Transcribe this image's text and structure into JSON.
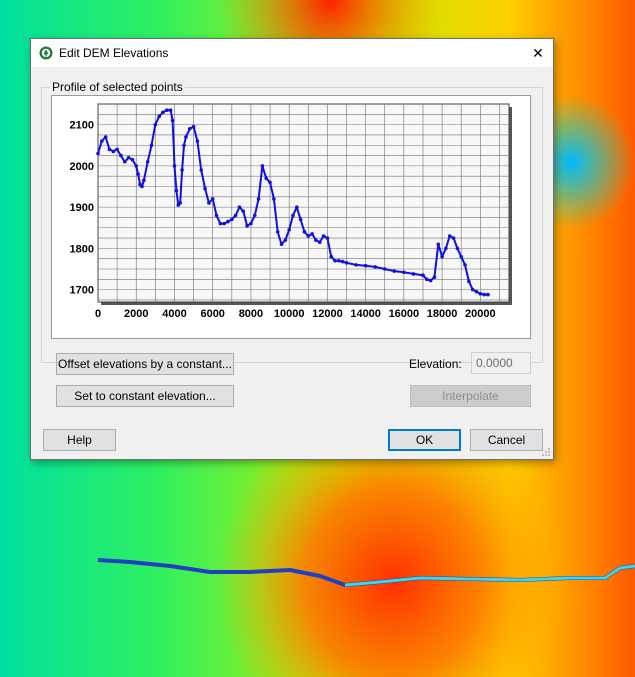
{
  "dialog": {
    "title": "Edit DEM Elevations",
    "close_glyph": "✕",
    "app_icon": "arcgis-app-icon"
  },
  "profile": {
    "group_label": "Profile of selected points"
  },
  "controls": {
    "offset_button": "Offset elevations by a constant...",
    "set_constant_button": "Set to constant elevation...",
    "elevation_label": "Elevation:",
    "elevation_value": "0.0000",
    "interpolate_button": "Interpolate",
    "help_button": "Help",
    "ok_button": "OK",
    "cancel_button": "Cancel"
  },
  "colors": {
    "profile_line": "#1010e0",
    "grid": "#707070",
    "plot_bg": "#f7f7f7",
    "accent": "#0078d7"
  },
  "chart_data": {
    "type": "line",
    "title": "",
    "xlabel": "",
    "ylabel": "",
    "xlim": [
      0,
      21500
    ],
    "ylim": [
      1670,
      2150
    ],
    "x_ticks": [
      0,
      2000,
      4000,
      6000,
      8000,
      10000,
      12000,
      14000,
      16000,
      18000,
      20000
    ],
    "y_ticks": [
      1700,
      1800,
      1900,
      2000,
      2100
    ],
    "grid": true,
    "series": [
      {
        "x": [
          0,
          200,
          400,
          600,
          800,
          1000,
          1200,
          1400,
          1600,
          1800,
          2000,
          2100,
          2200,
          2300,
          2400,
          2600,
          2800,
          3000,
          3200,
          3400,
          3600,
          3800,
          3900,
          4000,
          4100,
          4200,
          4300,
          4400,
          4500,
          4600,
          4800,
          5000,
          5200,
          5400,
          5600,
          5800,
          6000,
          6200,
          6400,
          6600,
          6800,
          7000,
          7200,
          7400,
          7600,
          7800,
          8000,
          8200,
          8400,
          8600,
          8800,
          9000,
          9200,
          9400,
          9600,
          9800,
          10000,
          10200,
          10400,
          10600,
          10800,
          11000,
          11200,
          11400,
          11600,
          11800,
          12000,
          12200,
          12400,
          12600,
          12800,
          13000,
          13500,
          14000,
          14500,
          15000,
          15500,
          16000,
          16500,
          17000,
          17200,
          17400,
          17600,
          17800,
          18000,
          18200,
          18400,
          18600,
          18800,
          19000,
          19200,
          19400,
          19600,
          19800,
          20000,
          20200,
          20400
        ],
        "y": [
          2030,
          2060,
          2070,
          2040,
          2035,
          2040,
          2025,
          2010,
          2020,
          2015,
          2000,
          1980,
          1955,
          1950,
          1965,
          2010,
          2050,
          2100,
          2120,
          2130,
          2135,
          2135,
          2110,
          2000,
          1940,
          1905,
          1910,
          1990,
          2050,
          2070,
          2090,
          2095,
          2060,
          1990,
          1945,
          1910,
          1920,
          1880,
          1860,
          1860,
          1865,
          1870,
          1880,
          1900,
          1890,
          1855,
          1860,
          1880,
          1920,
          2000,
          1970,
          1960,
          1920,
          1840,
          1810,
          1820,
          1845,
          1880,
          1900,
          1870,
          1840,
          1830,
          1835,
          1820,
          1815,
          1830,
          1825,
          1780,
          1770,
          1770,
          1768,
          1765,
          1760,
          1758,
          1755,
          1750,
          1745,
          1742,
          1738,
          1735,
          1725,
          1722,
          1730,
          1810,
          1780,
          1800,
          1830,
          1825,
          1800,
          1780,
          1760,
          1720,
          1700,
          1695,
          1690,
          1688,
          1688
        ]
      }
    ]
  }
}
